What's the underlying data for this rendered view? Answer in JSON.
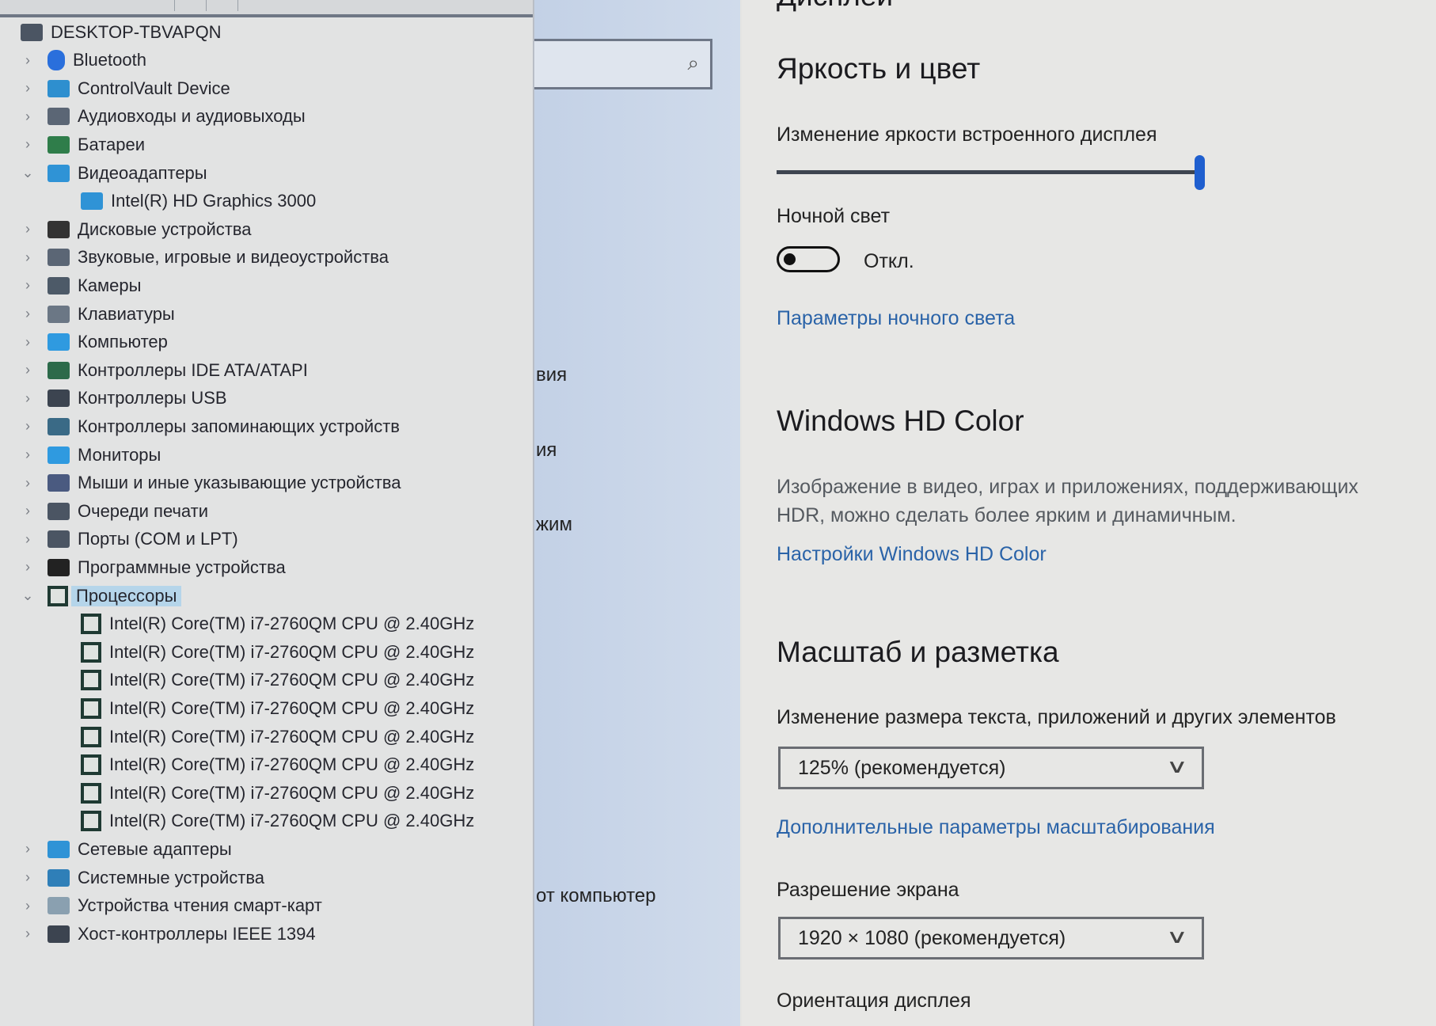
{
  "device_manager": {
    "root": "DESKTOP-TBVAPQN",
    "items": [
      {
        "label": "Bluetooth",
        "icon": "bluetooth-icon",
        "expanded": false,
        "color": "#2a6fdc"
      },
      {
        "label": "ControlVault Device",
        "icon": "controlvault-icon",
        "expanded": false,
        "color": "#2e8fcf"
      },
      {
        "label": "Аудиовходы и аудиовыходы",
        "icon": "speaker-icon",
        "expanded": false,
        "color": "#5b6675"
      },
      {
        "label": "Батареи",
        "icon": "battery-icon",
        "expanded": false,
        "color": "#2f7d4a"
      },
      {
        "label": "Видеоадаптеры",
        "icon": "display-adapter-icon",
        "expanded": true,
        "color": "#2f93d6",
        "children": [
          "Intel(R) HD Graphics 3000"
        ]
      },
      {
        "label": "Дисковые устройства",
        "icon": "disk-drive-icon",
        "expanded": false,
        "color": "#333"
      },
      {
        "label": "Звуковые, игровые и видеоустройства",
        "icon": "speaker-icon",
        "expanded": false,
        "color": "#5b6675"
      },
      {
        "label": "Камеры",
        "icon": "camera-icon",
        "expanded": false,
        "color": "#4d5a68"
      },
      {
        "label": "Клавиатуры",
        "icon": "keyboard-icon",
        "expanded": false,
        "color": "#6b7785"
      },
      {
        "label": "Компьютер",
        "icon": "computer-icon",
        "expanded": false,
        "color": "#2f9ae0"
      },
      {
        "label": "Контроллеры IDE ATA/ATAPI",
        "icon": "ide-controller-icon",
        "expanded": false,
        "color": "#2c6a4a"
      },
      {
        "label": "Контроллеры USB",
        "icon": "usb-icon",
        "expanded": false,
        "color": "#3c4450"
      },
      {
        "label": "Контроллеры запоминающих устройств",
        "icon": "storage-controller-icon",
        "expanded": false,
        "color": "#3a6a86"
      },
      {
        "label": "Мониторы",
        "icon": "monitor-icon",
        "expanded": false,
        "color": "#2f9ae0"
      },
      {
        "label": "Мыши и иные указывающие устройства",
        "icon": "mouse-icon",
        "expanded": false,
        "color": "#4a5a80"
      },
      {
        "label": "Очереди печати",
        "icon": "printer-icon",
        "expanded": false,
        "color": "#4b5563"
      },
      {
        "label": "Порты (COM и LPT)",
        "icon": "port-icon",
        "expanded": false,
        "color": "#4b5563"
      },
      {
        "label": "Программные устройства",
        "icon": "software-device-icon",
        "expanded": false,
        "color": "#222"
      },
      {
        "label": "Процессоры",
        "icon": "processor-icon",
        "expanded": true,
        "selected": true,
        "color": "#1f3a33",
        "children": [
          "Intel(R) Core(TM) i7-2760QM CPU @ 2.40GHz",
          "Intel(R) Core(TM) i7-2760QM CPU @ 2.40GHz",
          "Intel(R) Core(TM) i7-2760QM CPU @ 2.40GHz",
          "Intel(R) Core(TM) i7-2760QM CPU @ 2.40GHz",
          "Intel(R) Core(TM) i7-2760QM CPU @ 2.40GHz",
          "Intel(R) Core(TM) i7-2760QM CPU @ 2.40GHz",
          "Intel(R) Core(TM) i7-2760QM CPU @ 2.40GHz",
          "Intel(R) Core(TM) i7-2760QM CPU @ 2.40GHz"
        ]
      },
      {
        "label": "Сетевые адаптеры",
        "icon": "network-adapter-icon",
        "expanded": false,
        "color": "#2f93d6"
      },
      {
        "label": "Системные устройства",
        "icon": "system-device-icon",
        "expanded": false,
        "color": "#2f7fb8"
      },
      {
        "label": "Устройства чтения смарт-карт",
        "icon": "smartcard-reader-icon",
        "expanded": false,
        "color": "#8aa0b0"
      },
      {
        "label": "Хост-контроллеры IEEE 1394",
        "icon": "ieee1394-icon",
        "expanded": false,
        "color": "#3c4450"
      }
    ]
  },
  "settings_nav": {
    "partial_items": [
      "вия",
      "ия",
      "жим",
      "от компьютер"
    ]
  },
  "display": {
    "page_title": "Дисплей",
    "brightness_section": "Яркость и цвет",
    "brightness_label": "Изменение яркости встроенного дисплея",
    "brightness_value_percent": 100,
    "night_light_label": "Ночной свет",
    "night_light_state": "Откл.",
    "night_light_on": false,
    "night_light_link": "Параметры ночного света",
    "hdr_section": "Windows HD Color",
    "hdr_desc_1": "Изображение в видео, играх и приложениях, поддерживающих",
    "hdr_desc_2": "HDR, можно сделать более ярким и динамичным.",
    "hdr_link": "Настройки Windows HD Color",
    "scale_section": "Масштаб и разметка",
    "scale_label": "Изменение размера текста, приложений и других элементов",
    "scale_value": "125% (рекомендуется)",
    "scale_link": "Дополнительные параметры масштабирования",
    "resolution_label": "Разрешение экрана",
    "resolution_value": "1920 × 1080 (рекомендуется)",
    "orientation_label": "Ориентация дисплея"
  },
  "colors": {
    "accent": "#1f5fcf",
    "link": "#2a63a8",
    "selection": "#b5d5ea"
  }
}
